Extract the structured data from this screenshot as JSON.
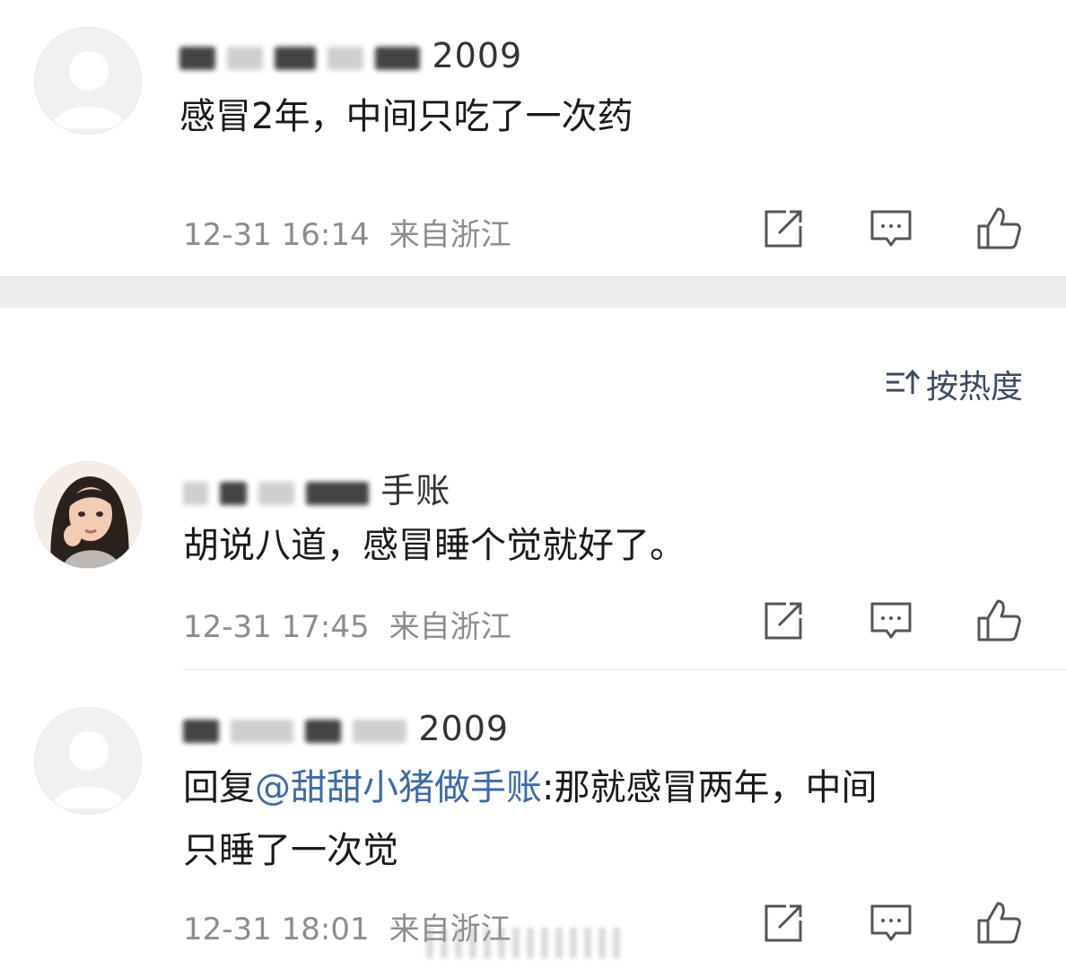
{
  "top_comment": {
    "username_visible": "2009",
    "text": "感冒2年，中间只吃了一次药",
    "time": "12-31 16:14",
    "location": "来自浙江"
  },
  "sort": {
    "label": "按热度",
    "icon": "sort-icon"
  },
  "replies": [
    {
      "username_visible": "手账",
      "text": "胡说八道，感冒睡个觉就好了。",
      "time": "12-31 17:45",
      "location": "来自浙江"
    },
    {
      "username_visible": "2009",
      "reply_prefix": "回复",
      "mention": "@甜甜小猪做手账",
      "text_line1": ":那就感冒两年，中间",
      "text_line2": "只睡了一次觉",
      "time": "12-31 18:01",
      "location": "来自浙江"
    }
  ],
  "icons": {
    "share": "share-icon",
    "comment": "comment-icon",
    "like": "thumbs-up-icon"
  },
  "colors": {
    "mention": "#3e6aa8",
    "meta": "#8c8c8c",
    "sort": "#3b4a63",
    "divider": "#ededed"
  }
}
